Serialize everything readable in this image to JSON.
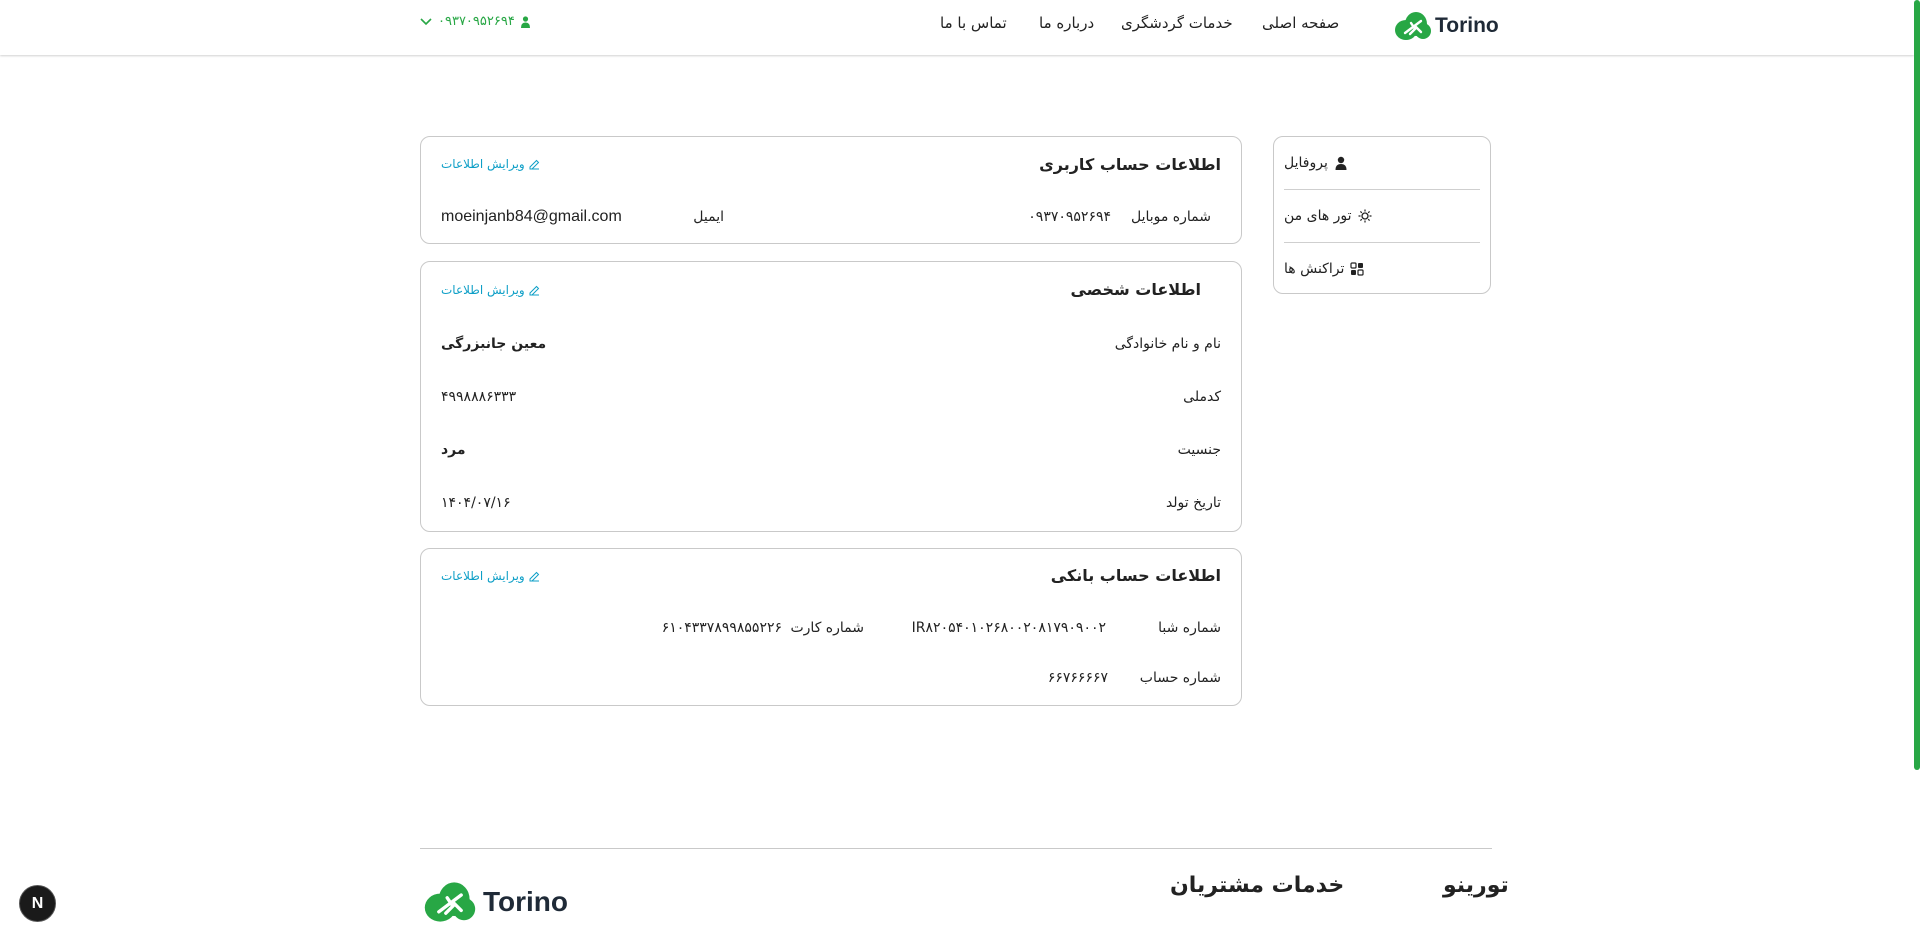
{
  "header": {
    "logo_text": "Torino",
    "nav": [
      "صفحه اصلی",
      "خدمات گردشگری",
      "درباره ما",
      "تماس با ما"
    ],
    "phone": "۰۹۳۷۰۹۵۲۶۹۴"
  },
  "sidebar": {
    "items": [
      {
        "label": "پروفایل",
        "icon": "user-icon"
      },
      {
        "label": "تور های من",
        "icon": "sun-icon"
      },
      {
        "label": "تراکنش ها",
        "icon": "transactions-icon"
      }
    ]
  },
  "account": {
    "title": "اطلاعات حساب کاربری",
    "edit_label": "ویرایش اطلاعات",
    "mobile_label": "شماره موبایل",
    "mobile_value": "۰۹۳۷۰۹۵۲۶۹۴",
    "email_label": "ایمیل",
    "email_value": "moeinjanb84@gmail.com"
  },
  "personal": {
    "title": "اطلاعات شخصی",
    "edit_label": "ویرایش اطلاعات",
    "name_label": "نام و نام خانوادگی",
    "name_value": "معین جانبزرگی",
    "national_label": "کدملی",
    "national_value": "۴۹۹۸۸۸۶۳۳۳",
    "gender_label": "جنسیت",
    "gender_value": "مرد",
    "birth_label": "تاریخ تولد",
    "birth_value": "۱۴۰۴/۰۷/۱۶"
  },
  "bank": {
    "title": "اطلاعات حساب بانکی",
    "edit_label": "ویرایش اطلاعات",
    "sheba_label": "شماره شبا",
    "sheba_value": "IR۸۲۰۵۴۰۱۰۲۶۸۰۰۲۰۸۱۷۹۰۹۰۰۲",
    "card_label": "شماره کارت",
    "card_value": "۶۱۰۴۳۳۷۸۹۹۸۵۵۲۲۶",
    "account_label": "شماره حساب",
    "account_value": "۶۶۷۶۶۶۶۷"
  },
  "footer": {
    "col1_title": "تورینو",
    "col2_title": "خدمات مشتریان",
    "logo_text": "Torino"
  },
  "dev_button": "N",
  "colors": {
    "brand": "#28a745",
    "link": "#0e9fc7"
  }
}
